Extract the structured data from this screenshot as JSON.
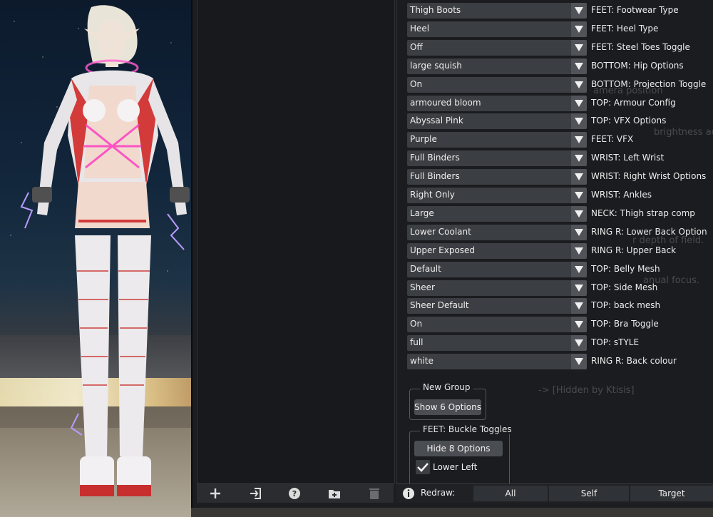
{
  "options": [
    {
      "value": "Thigh Boots",
      "label": "FEET: Footwear Type"
    },
    {
      "value": "Heel",
      "label": "FEET: Heel Type"
    },
    {
      "value": "Off",
      "label": "FEET: Steel Toes Toggle"
    },
    {
      "value": "large squish",
      "label": "BOTTOM: Hip Options"
    },
    {
      "value": "On",
      "label": "BOTTOM: Projection Toggle"
    },
    {
      "value": "armoured bloom",
      "label": "TOP: Armour Config"
    },
    {
      "value": "Abyssal Pink",
      "label": "TOP: VFX Options"
    },
    {
      "value": "Purple",
      "label": "FEET: VFX"
    },
    {
      "value": "Full Binders",
      "label": "WRIST: Left Wrist"
    },
    {
      "value": "Full Binders",
      "label": "WRIST: Right Wrist Options"
    },
    {
      "value": "Right Only",
      "label": "WRIST: Ankles"
    },
    {
      "value": "Large",
      "label": "NECK: Thigh strap comp"
    },
    {
      "value": "Lower Coolant",
      "label": "RING R: Lower Back Option"
    },
    {
      "value": "Upper Exposed",
      "label": "RING R: Upper Back"
    },
    {
      "value": "Default",
      "label": "TOP: Belly Mesh"
    },
    {
      "value": "Sheer",
      "label": "TOP: Side Mesh"
    },
    {
      "value": "Sheer Default",
      "label": "TOP: back mesh"
    },
    {
      "value": "On",
      "label": "TOP: Bra Toggle"
    },
    {
      "value": "full",
      "label": "TOP: sTYLE"
    },
    {
      "value": "white",
      "label": "RING R: Back colour"
    }
  ],
  "groups": {
    "new_group": {
      "title": "New Group",
      "button": "Show 6 Options"
    },
    "buckle": {
      "title": "FEET: Buckle Toggles",
      "button": "Hide 8 Options",
      "checkbox_label": "Lower Left",
      "checked": true
    }
  },
  "background_text": {
    "camera_position": "amera position",
    "brightness": "brightness adjus",
    "field": "r depth of field.",
    "focus": "anual focus.",
    "hidden": "-> [Hidden by Ktisis]"
  },
  "footer": {
    "redraw_label": "Redraw:",
    "buttons": [
      "All",
      "Self",
      "Target"
    ],
    "icons": [
      "add-icon",
      "import-icon",
      "help-icon",
      "add-folder-icon",
      "trash-icon",
      "info-icon"
    ]
  },
  "colors": {
    "panel": "#1b1d20",
    "combo": "#3b3e42",
    "button": "#4a4d52"
  }
}
